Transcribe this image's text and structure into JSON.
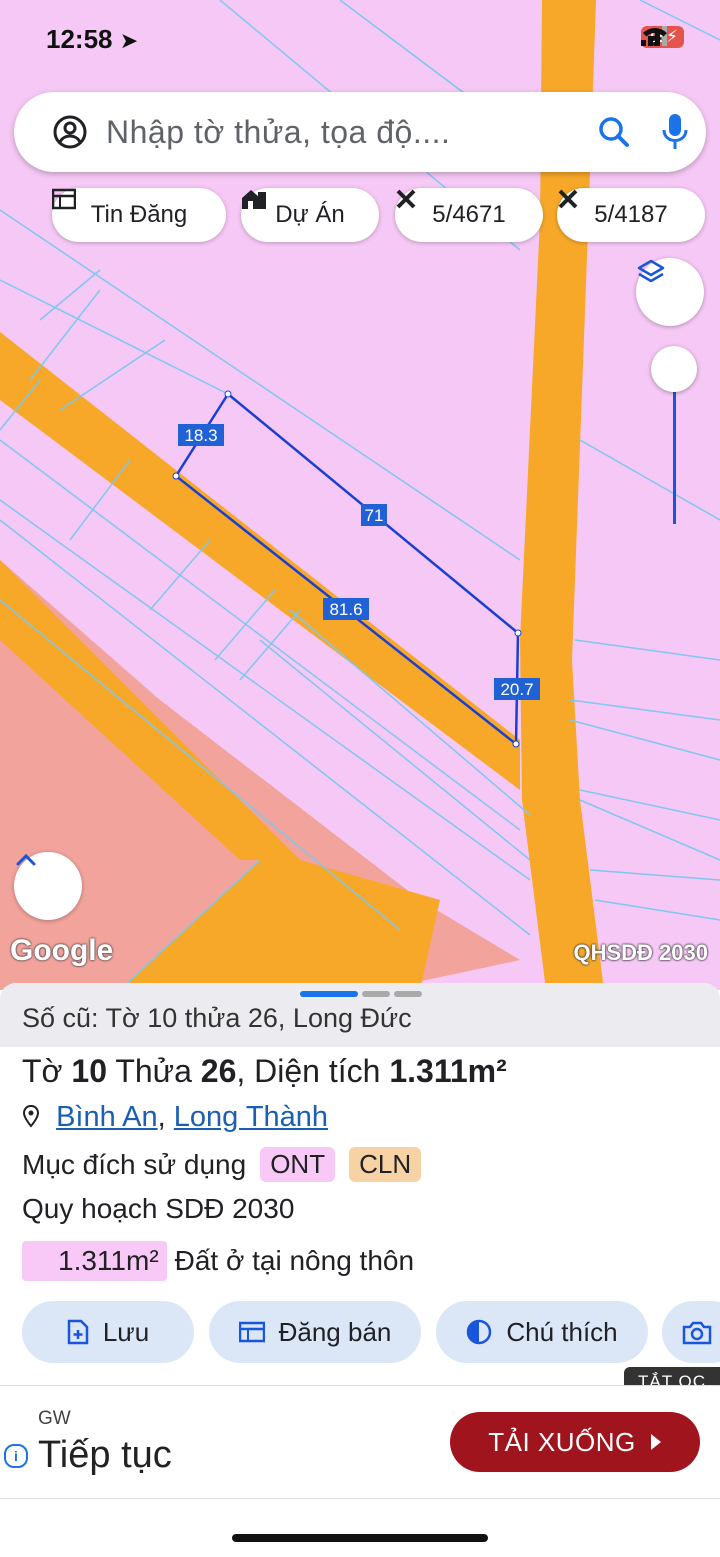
{
  "status": {
    "time": "12:58",
    "battery": "18"
  },
  "search": {
    "placeholder": "Nhập tờ thửa, tọa độ...."
  },
  "chips": [
    {
      "label": "Tin Đăng",
      "icon": "listing-icon"
    },
    {
      "label": "Dự Án",
      "icon": "building-icon"
    },
    {
      "label": "5/4671",
      "icon": "measure-icon"
    },
    {
      "label": "5/4187",
      "icon": "measure-icon"
    }
  ],
  "map": {
    "parcel_dimensions": [
      "18.3",
      "71",
      "81.6",
      "20.7"
    ],
    "watermark": "Google",
    "layer_label": "QHSDĐ 2030",
    "colors": {
      "residential": "#f6c8f5",
      "road": "#f7a829",
      "commercial": "#f2a39c",
      "boundary": "#1b3fd0"
    }
  },
  "sheet": {
    "old_record": "Số cũ: Tờ 10 thửa 26, Long Đức",
    "title": {
      "to_label": "Tờ",
      "to_num": "10",
      "thua_label": "Thửa",
      "thua_num": "26",
      "dt_label": ", Diện tích",
      "area": "1.311m²"
    },
    "location": {
      "ward": "Bình An",
      "sep": ",",
      "district": "Long Thành"
    },
    "purpose": {
      "label": "Mục đích sử dụng",
      "tags": [
        "ONT",
        "CLN"
      ]
    },
    "plan": "Quy hoạch SDĐ 2030",
    "plan_area": {
      "value": "1.311m²",
      "desc": "Đất ở tại nông thôn"
    },
    "actions": [
      {
        "label": "Lưu",
        "icon": "save-icon"
      },
      {
        "label": "Đăng bán",
        "icon": "post-icon"
      },
      {
        "label": "Chú thích",
        "icon": "legend-icon"
      }
    ],
    "hide_ad": "TẮT QC"
  },
  "ad": {
    "brand": "GW",
    "title": "Tiếp tục",
    "button": "TẢI XUỐNG"
  }
}
